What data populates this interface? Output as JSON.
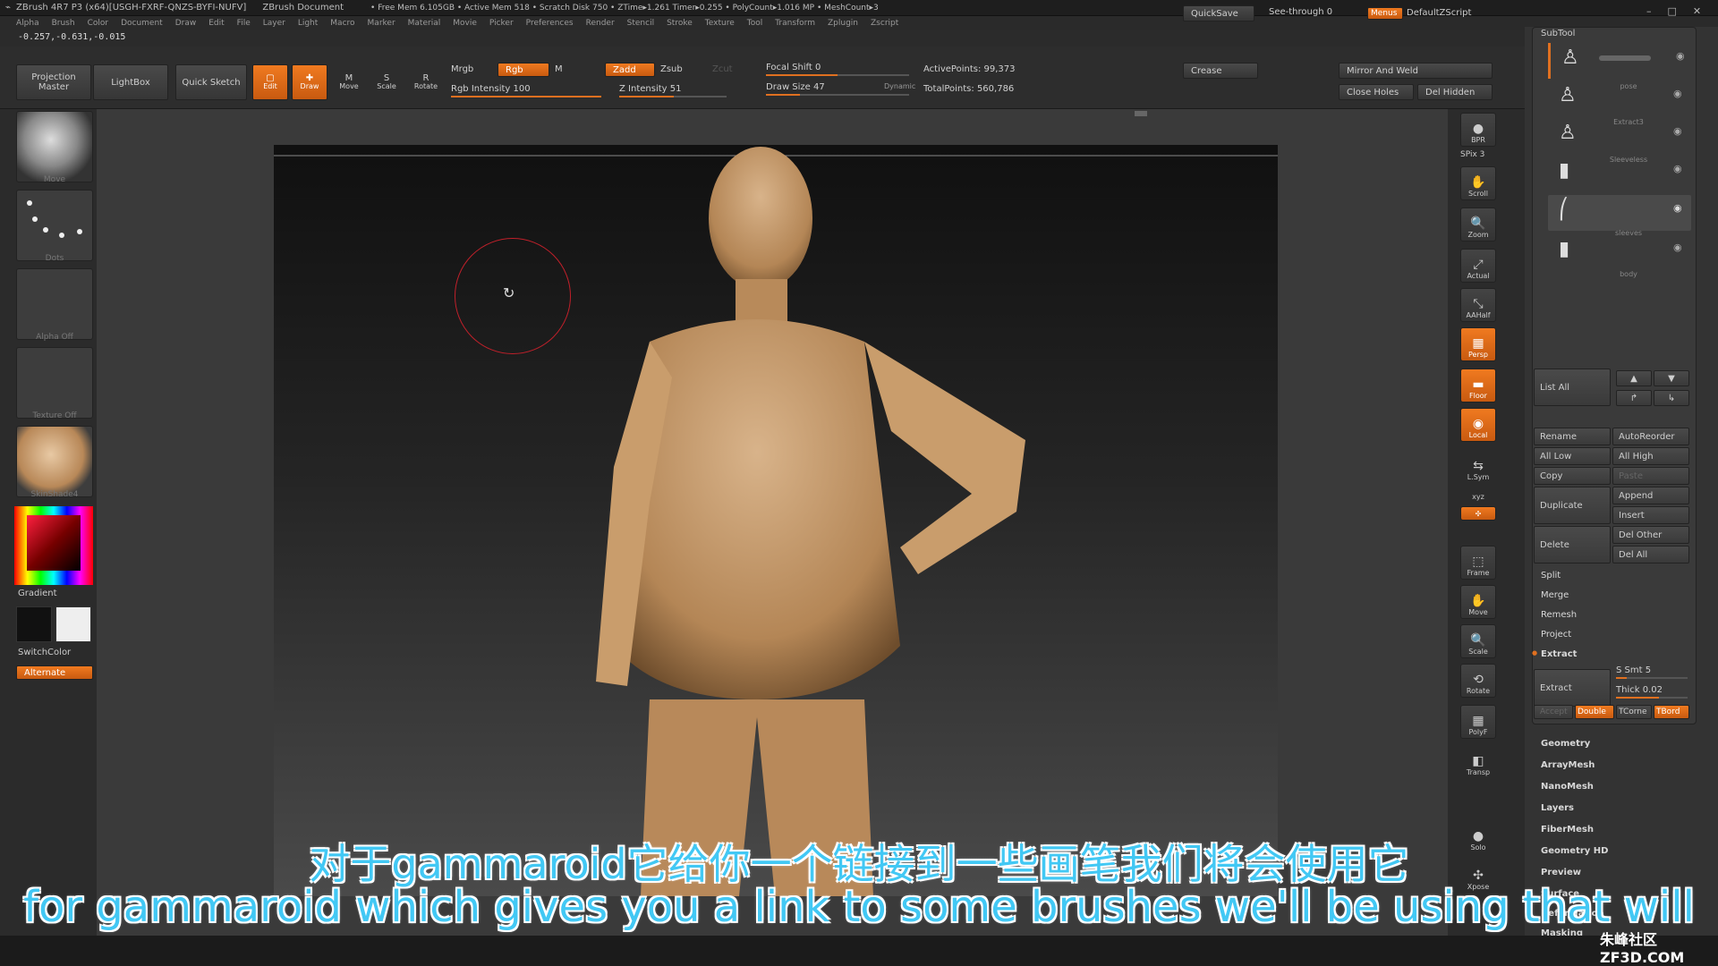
{
  "title_bar": {
    "app": "ZBrush 4R7 P3 (x64)[USGH-FXRF-QNZS-BYFI-NUFV]",
    "document": "ZBrush Document",
    "stats": "• Free Mem 6.105GB • Active Mem 518 • Scratch Disk 750 • ZTime▸1.261 Timer▸0.255 • PolyCount▸1.016 MP • MeshCount▸3",
    "quicksave": "QuickSave",
    "see_through": "See-through  0",
    "menus": "Menus",
    "default_zscript": "DefaultZScript"
  },
  "menu": [
    "Alpha",
    "Brush",
    "Color",
    "Document",
    "Draw",
    "Edit",
    "File",
    "Layer",
    "Light",
    "Macro",
    "Marker",
    "Material",
    "Movie",
    "Picker",
    "Preferences",
    "Render",
    "Stencil",
    "Stroke",
    "Texture",
    "Tool",
    "Transform",
    "Zplugin",
    "Zscript"
  ],
  "coords": "-0.257,-0.631,-0.015",
  "toolbar": {
    "projection_master": "Projection Master",
    "lightbox": "LightBox",
    "quick_sketch": "Quick Sketch",
    "edit": "Edit",
    "draw": "Draw",
    "move": "Move",
    "scale": "Scale",
    "rotate": "Rotate",
    "mrgb": "Mrgb",
    "rgb": "Rgb",
    "m": "M",
    "rgb_intensity": "Rgb Intensity 100",
    "zadd": "Zadd",
    "zsub": "Zsub",
    "zcut": "Zcut",
    "z_intensity": "Z Intensity 51",
    "focal_shift": "Focal Shift 0",
    "draw_size": "Draw Size 47",
    "dynamic": "Dynamic",
    "active_points": "ActivePoints: 99,373",
    "total_points": "TotalPoints: 560,786",
    "crease": "Crease",
    "mirror_weld": "Mirror And Weld",
    "close_holes": "Close Holes",
    "del_hidden": "Del Hidden"
  },
  "left": {
    "brush": "Move",
    "stroke": "Dots",
    "alpha": "Alpha Off",
    "texture": "Texture Off",
    "material": "SkinShade4",
    "gradient": "Gradient",
    "switch_color": "SwitchColor",
    "alternate": "Alternate"
  },
  "shelf": [
    {
      "label": "BPR",
      "icon": "●"
    },
    {
      "label": "SPix 3",
      "icon": ""
    },
    {
      "label": "Scroll",
      "icon": "✋"
    },
    {
      "label": "Zoom",
      "icon": "🔍"
    },
    {
      "label": "Actual",
      "icon": "⤢"
    },
    {
      "label": "AAHalf",
      "icon": "⤡"
    },
    {
      "label": "Persp",
      "icon": "▦"
    },
    {
      "label": "Floor",
      "icon": "▬"
    },
    {
      "label": "Local",
      "icon": "◉"
    },
    {
      "label": "L.Sym",
      "icon": "⇆"
    },
    {
      "label": "xyz",
      "icon": "✣"
    },
    {
      "label": "Frame",
      "icon": "⬚"
    },
    {
      "label": "Move",
      "icon": "✋"
    },
    {
      "label": "Scale",
      "icon": "🔍"
    },
    {
      "label": "Rotate",
      "icon": "⟲"
    },
    {
      "label": "PolyF",
      "icon": "▦"
    },
    {
      "label": "Transp",
      "icon": "◧"
    },
    {
      "label": "Solo",
      "icon": "●"
    },
    {
      "label": "Xpose",
      "icon": "✣"
    }
  ],
  "subtool": {
    "header": "SubTool",
    "items": [
      "",
      "pose",
      "Extract3",
      "Sleeveless",
      "sleeves",
      "body"
    ],
    "list_all": "List All",
    "rename": "Rename",
    "auto_reorder": "AutoReorder",
    "all_low": "All Low",
    "all_high": "All High",
    "copy": "Copy",
    "paste": "Paste",
    "append": "Append",
    "duplicate": "Duplicate",
    "insert": "Insert",
    "delete": "Delete",
    "del_other": "Del Other",
    "del_all": "Del All",
    "split": "Split",
    "merge": "Merge",
    "remesh": "Remesh",
    "project": "Project",
    "extract_header": "Extract",
    "extract": "Extract",
    "s_smt": "S Smt 5",
    "thick": "Thick 0.02",
    "accept": "Accept",
    "double": "Double",
    "tcorne": "TCorne",
    "tbord": "TBord"
  },
  "tool_menus": [
    "Geometry",
    "ArrayMesh",
    "NanoMesh",
    "Layers",
    "FiberMesh",
    "Geometry HD",
    "Preview",
    "Surface",
    "Deformation",
    "Masking"
  ],
  "subtitles": {
    "zh": "对于gammaroid它给你一个链接到一些画笔我们将会使用它",
    "en": "for gammaroid which gives you a link to some brushes we'll be using that will"
  },
  "watermark": "朱峰社区 ZF3D.COM",
  "colors": {
    "accent": "#e8701a",
    "subtitle": "#42c8f4",
    "figure": "#c9a27a"
  }
}
